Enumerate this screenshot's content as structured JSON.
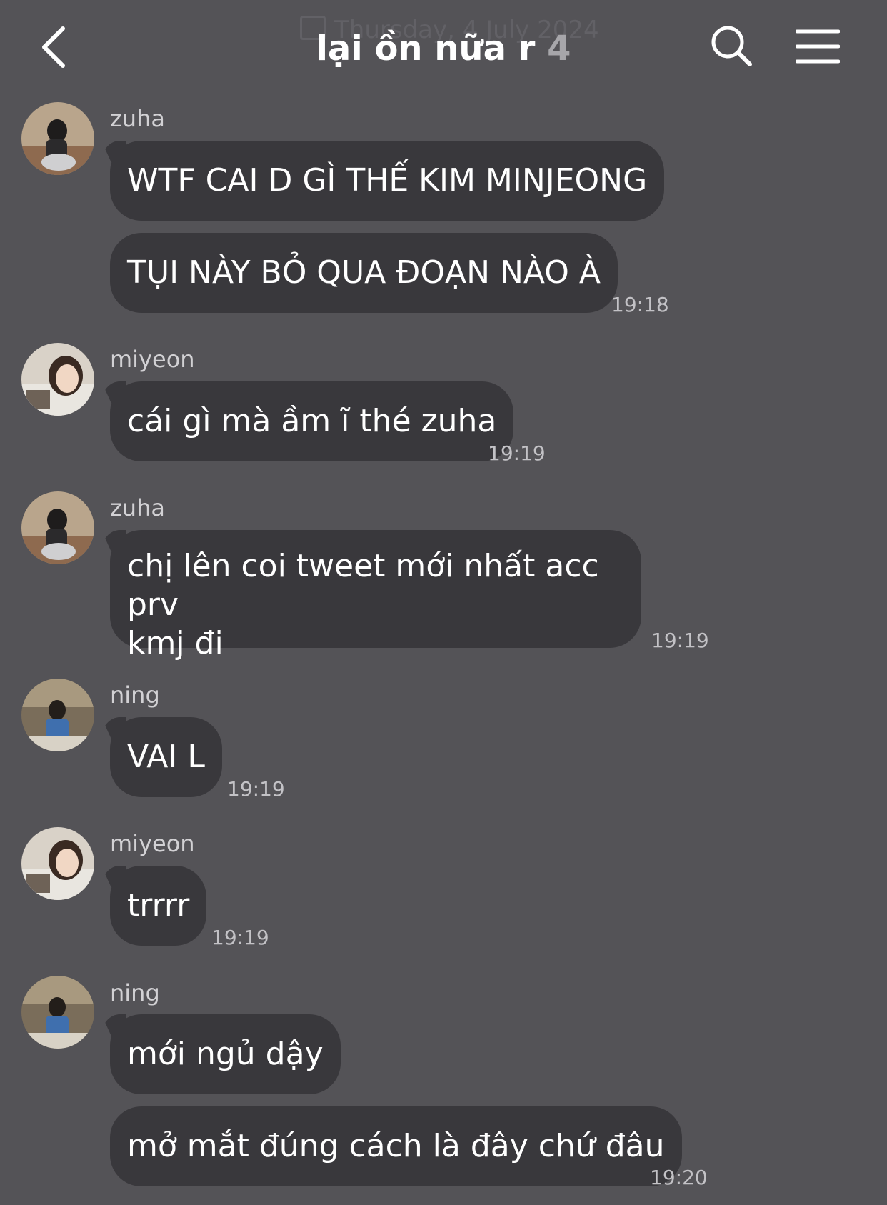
{
  "header": {
    "date_ghost": "Thursday, 4 July 2024",
    "title": "lại ồn nữa r",
    "member_count": "4",
    "back_icon": "chevron-left-icon",
    "search_icon": "search-icon",
    "menu_icon": "hamburger-menu-icon"
  },
  "colors": {
    "background": "#545357",
    "bubble": "#39383c",
    "text": "#ffffff",
    "muted": "#c3c2c6"
  },
  "messages": [
    {
      "sender": "zuha",
      "bubbles": [
        "WTF CAI D GÌ THẾ KIM MINJEONG",
        "TỤI NÀY BỎ QUA ĐOẠN NÀO À"
      ],
      "time": "19:18"
    },
    {
      "sender": "miyeon",
      "bubbles": [
        "cái gì mà ầm ĩ thé zuha"
      ],
      "time": "19:19"
    },
    {
      "sender": "zuha",
      "bubbles": [
        "chị lên coi tweet mới nhất acc prv\nkmj đi"
      ],
      "time": "19:19"
    },
    {
      "sender": "ning",
      "bubbles": [
        "VAI L"
      ],
      "time": "19:19"
    },
    {
      "sender": "miyeon",
      "bubbles": [
        "trrrr"
      ],
      "time": "19:19"
    },
    {
      "sender": "ning",
      "bubbles": [
        "mới ngủ dậy",
        "mở mắt đúng cách là đây chứ đâu"
      ],
      "time": "19:20"
    }
  ]
}
